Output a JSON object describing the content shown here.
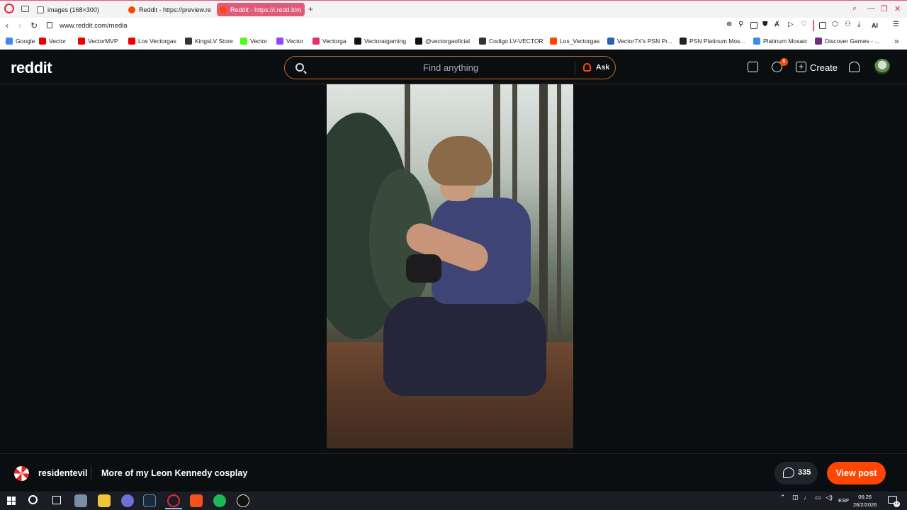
{
  "browser": {
    "tabs": [
      {
        "title": "images (168×300)",
        "favicon": "document-icon",
        "active": false
      },
      {
        "title": "Reddit - https://preview.re",
        "favicon": "reddit-icon",
        "active": false
      },
      {
        "title": "Reddit - https://i.redd.it/m",
        "favicon": "reddit-icon",
        "active": true
      }
    ],
    "new_tab_glyph": "+",
    "url": "www.reddit.com/media",
    "toolbar_ai_label": "AI",
    "bookmarks": [
      {
        "label": "Google",
        "icon": "google-icon",
        "color": "#4285f4"
      },
      {
        "label": "Vector",
        "icon": "youtube-icon",
        "color": "#e00"
      },
      {
        "label": "VectorMVP",
        "icon": "youtube-icon",
        "color": "#e00"
      },
      {
        "label": "Los Vectorgas",
        "icon": "youtube-icon",
        "color": "#e00"
      },
      {
        "label": "KingsLV Store",
        "icon": "crown-icon",
        "color": "#333"
      },
      {
        "label": "Vector",
        "icon": "kick-icon",
        "color": "#53fc18"
      },
      {
        "label": "Vector",
        "icon": "twitch-icon",
        "color": "#9146ff"
      },
      {
        "label": "Vectorga",
        "icon": "instagram-icon",
        "color": "#e1306c"
      },
      {
        "label": "Vectoratgaming",
        "icon": "x-icon",
        "color": "#111"
      },
      {
        "label": "@vectorgaoficial",
        "icon": "tiktok-icon",
        "color": "#111"
      },
      {
        "label": "Codigo LV-VECTOR",
        "icon": "store-icon",
        "color": "#333"
      },
      {
        "label": "Los_Vectorgas",
        "icon": "reddit-icon",
        "color": "#ff4500"
      },
      {
        "label": "Vector7X's PSN Pr...",
        "icon": "psn-icon",
        "color": "#2b5fb3"
      },
      {
        "label": "PSN Platinum Mos...",
        "icon": "psnp-icon",
        "color": "#222"
      },
      {
        "label": "Platinum Mosaic",
        "icon": "trophy-icon",
        "color": "#3a8ee6"
      },
      {
        "label": "Discover Games - ...",
        "icon": "game-icon",
        "color": "#6b2d7a"
      }
    ]
  },
  "reddit": {
    "logo": "reddit",
    "search_placeholder": "Find anything",
    "ask_label": "Ask",
    "notification_badge": "5",
    "create_label": "Create",
    "subreddit": "residentevil",
    "post_title": "More of my Leon Kennedy cosplay",
    "comment_count": "335",
    "view_post_label": "View post",
    "accent_color": "#ff4500"
  },
  "taskbar": {
    "tray_language": "ESP",
    "clock_time": "06:26",
    "clock_date": "26/2/2026",
    "notification_count": "12"
  }
}
